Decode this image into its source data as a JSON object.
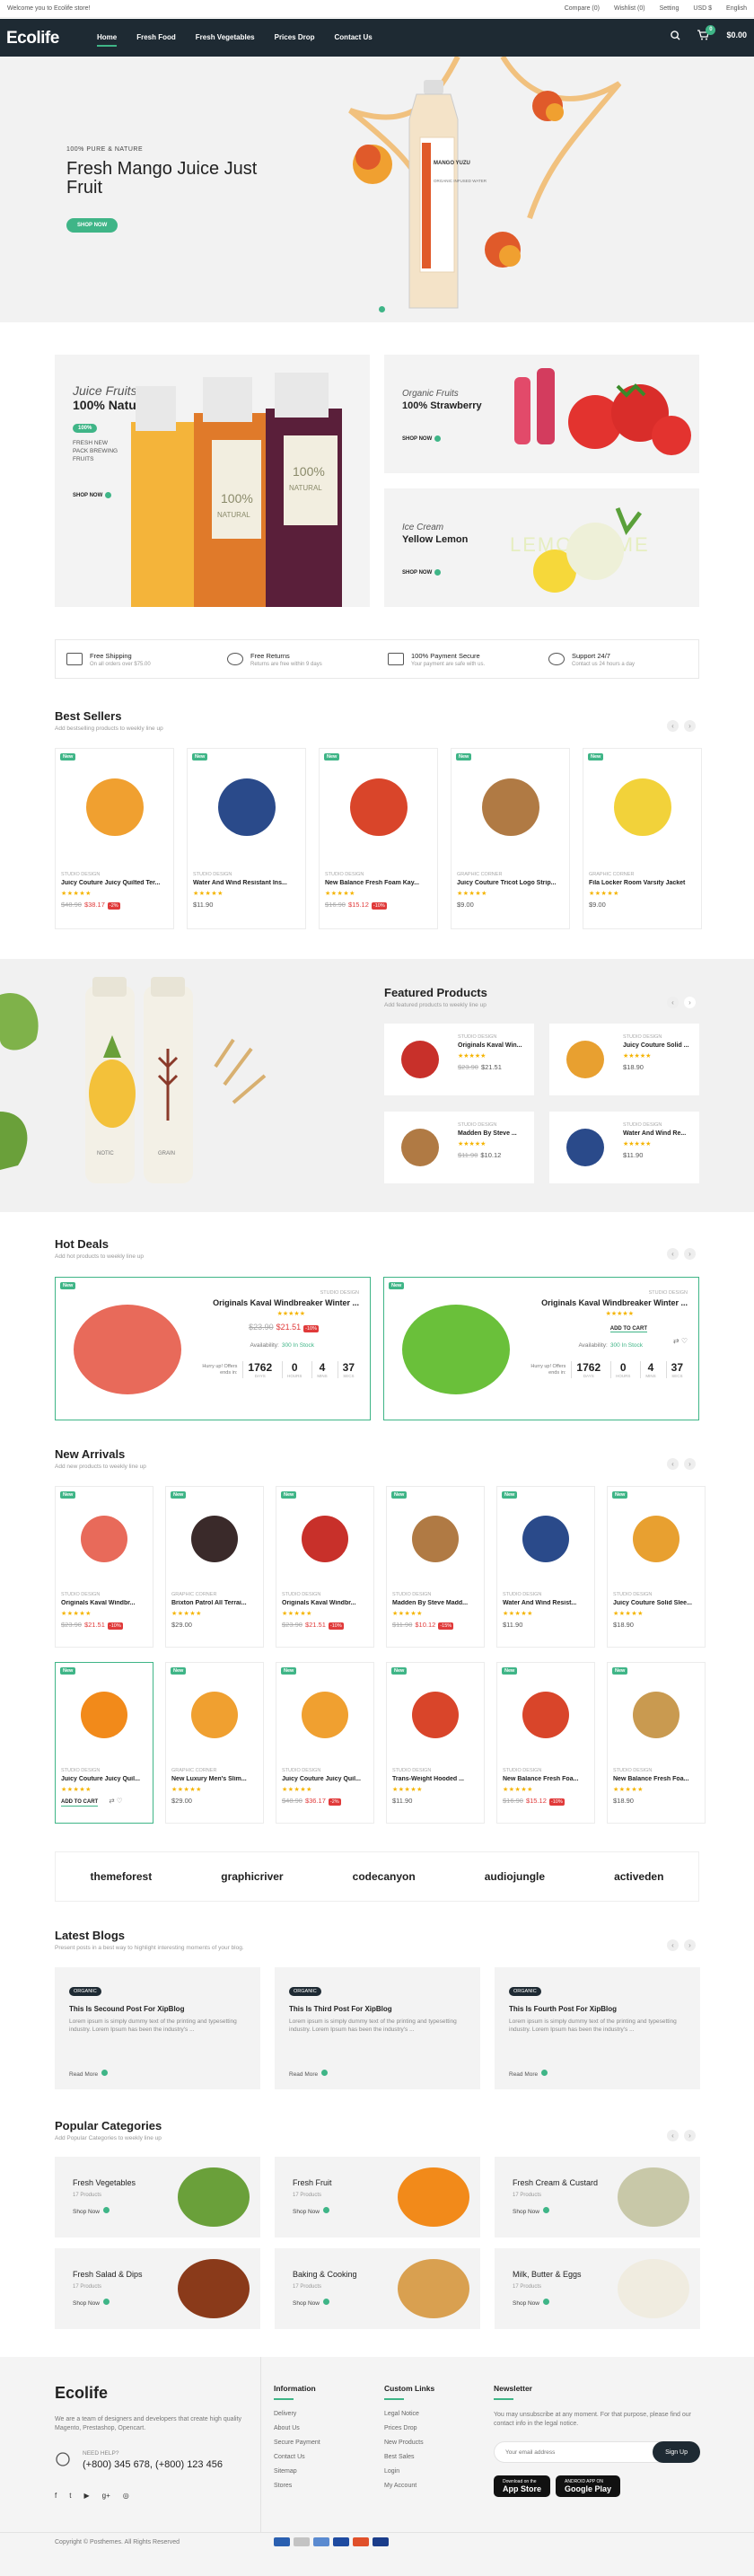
{
  "topbar": {
    "welcome": "Welcome you to Ecolife store!",
    "links": [
      "Compare (0)",
      "Wishlist (0)",
      "Setting",
      "USD $",
      "English"
    ]
  },
  "nav": {
    "logo": "Ecolife",
    "menu": [
      "Home",
      "Fresh Food",
      "Fresh Vegetables",
      "Prices Drop",
      "Contact Us"
    ],
    "cart_count": "0",
    "cart_total": "$0.00"
  },
  "hero": {
    "subtitle": "100% PURE & NATURE",
    "title": "Fresh Mango Juice Just Fruit",
    "button": "SHOP NOW",
    "bottle_label": "MANGO YUZU",
    "bottle_sub": "ORGANIC INFUSED WATER"
  },
  "banners": {
    "b1": {
      "t1": "Juice Fruits",
      "t2": "100% Natural",
      "tag": "100%",
      "desc": "FRESH NEW PACK BREWING FRUITS",
      "link": "SHOP NOW",
      "label": "NATURAL",
      "label2": "100%"
    },
    "b2": {
      "t1": "Organic Fruits",
      "t2": "100% Strawberry",
      "link": "SHOP NOW"
    },
    "b3": {
      "t1": "Ice Cream",
      "t2": "Yellow Lemon",
      "link": "SHOP NOW",
      "bg": "LEMON LIME"
    }
  },
  "features": [
    {
      "title": "Free Shipping",
      "desc": "On all orders over $75.00"
    },
    {
      "title": "Free Returns",
      "desc": "Returns are free within 9 days"
    },
    {
      "title": "100% Payment Secure",
      "desc": "Your payment are safe with us."
    },
    {
      "title": "Support 24/7",
      "desc": "Contact us 24 hours a day"
    }
  ],
  "best_sellers": {
    "title": "Best Sellers",
    "subtitle": "Add bestselling products to weekly line up",
    "items": [
      {
        "brand": "STUDIO DESIGN",
        "name": "Juicy Couture Juicy Quilted Ter...",
        "old": "$48.90",
        "price": "$38.17",
        "off": "-2%"
      },
      {
        "brand": "STUDIO DESIGN",
        "name": "Water And Wind Resistant Ins...",
        "price": "$11.90"
      },
      {
        "brand": "STUDIO DESIGN",
        "name": "New Balance Fresh Foam Kay...",
        "old": "$16.90",
        "price": "$15.12",
        "off": "-10%"
      },
      {
        "brand": "GRAPHIC CORNER",
        "name": "Juicy Couture Tricot Logo Strip...",
        "price": "$9.00"
      },
      {
        "brand": "GRAPHIC CORNER",
        "name": "Fila Locker Room Varsity Jacket",
        "price": "$9.00"
      }
    ]
  },
  "featured": {
    "title": "Featured Products",
    "subtitle": "Add featured products to weekly line up",
    "items": [
      {
        "brand": "STUDIO DESIGN",
        "name": "Originals Kaval Win...",
        "old": "$23.90",
        "price": "$21.51"
      },
      {
        "brand": "STUDIO DESIGN",
        "name": "Juicy Couture Solid ...",
        "price": "$18.90"
      },
      {
        "brand": "STUDIO DESIGN",
        "name": "Madden By Steve ...",
        "old": "$11.90",
        "price": "$10.12"
      },
      {
        "brand": "STUDIO DESIGN",
        "name": "Water And Wind Re...",
        "price": "$11.90"
      }
    ],
    "bottle1": "NOTIC",
    "bottle2": "GRAIN"
  },
  "hot_deals": {
    "title": "Hot Deals",
    "subtitle": "Add hot products to weekly line up",
    "items": [
      {
        "brand": "STUDIO DESIGN",
        "name": "Originals Kaval Windbreaker Winter ...",
        "old": "$23.90",
        "price": "$21.51",
        "off": "-10%",
        "availability": "Availability:",
        "stock": "300 In Stock",
        "hurry": "Hurry up! Offers ends in:",
        "d": "1762",
        "h": "0",
        "m": "4",
        "s": "37"
      },
      {
        "brand": "STUDIO DESIGN",
        "name": "Originals Kaval Windbreaker Winter ...",
        "cart": "ADD TO CART",
        "availability": "Availability:",
        "stock": "300 In Stock",
        "hurry": "Hurry up! Offers ends in:",
        "d": "1762",
        "h": "0",
        "m": "4",
        "s": "37"
      }
    ],
    "labels": {
      "d": "DAYS",
      "h": "HOURS",
      "m": "MINS",
      "s": "SECS"
    }
  },
  "new_arrivals": {
    "title": "New Arrivals",
    "subtitle": "Add new products to weekly line up",
    "row1": [
      {
        "brand": "STUDIO DESIGN",
        "name": "Originals Kaval Windbr...",
        "old": "$23.90",
        "price": "$21.51",
        "off": "-10%"
      },
      {
        "brand": "GRAPHIC CORNER",
        "name": "Brixton Patrol All Terrai...",
        "price": "$29.00"
      },
      {
        "brand": "STUDIO DESIGN",
        "name": "Originals Kaval Windbr...",
        "old": "$23.90",
        "price": "$21.51",
        "off": "-10%"
      },
      {
        "brand": "STUDIO DESIGN",
        "name": "Madden By Steve Madd...",
        "old": "$11.90",
        "price": "$10.12",
        "off": "-15%"
      },
      {
        "brand": "STUDIO DESIGN",
        "name": "Water And Wind Resist...",
        "price": "$11.90"
      },
      {
        "brand": "STUDIO DESIGN",
        "name": "Juicy Couture Solid Slee...",
        "price": "$18.90"
      }
    ],
    "row2": [
      {
        "brand": "STUDIO DESIGN",
        "name": "Juicy Couture Juicy Quil...",
        "cart": "ADD TO CART"
      },
      {
        "brand": "GRAPHIC CORNER",
        "name": "New Luxury Men's Slim...",
        "price": "$29.00"
      },
      {
        "brand": "STUDIO DESIGN",
        "name": "Juicy Couture Juicy Quil...",
        "old": "$48.90",
        "price": "$36.17",
        "off": "-2%"
      },
      {
        "brand": "STUDIO DESIGN",
        "name": "Trans-Weight Hooded ...",
        "price": "$11.90"
      },
      {
        "brand": "STUDIO DESIGN",
        "name": "New Balance Fresh Foa...",
        "old": "$16.90",
        "price": "$15.12",
        "off": "-10%"
      },
      {
        "brand": "STUDIO DESIGN",
        "name": "New Balance Fresh Foa...",
        "price": "$18.90"
      }
    ]
  },
  "brands": [
    "themeforest",
    "graphicriver",
    "codecanyon",
    "audiojungle",
    "activeden"
  ],
  "blogs": {
    "title": "Latest Blogs",
    "subtitle": "Present posts in a best way to highlight interesting moments of your blog.",
    "items": [
      {
        "tag": "ORGANIC",
        "title": "This Is Secound Post For XipBlog",
        "body": "Lorem ipsum is simply dummy text of the printing and typesetting industry. Lorem Ipsum has been the industry's ...",
        "more": "Read More"
      },
      {
        "tag": "ORGANIC",
        "title": "This Is Third Post For XipBlog",
        "body": "Lorem ipsum is simply dummy text of the printing and typesetting industry. Lorem Ipsum has been the industry's ...",
        "more": "Read More"
      },
      {
        "tag": "ORGANIC",
        "title": "This Is Fourth Post For XipBlog",
        "body": "Lorem ipsum is simply dummy text of the printing and typesetting industry. Lorem Ipsum has been the industry's ...",
        "more": "Read More"
      }
    ]
  },
  "categories": {
    "title": "Popular Categories",
    "subtitle": "Add Popular Categories to weekly line up",
    "items": [
      {
        "name": "Fresh Vegetables",
        "count": "17 Products",
        "link": "Shop Now"
      },
      {
        "name": "Fresh Fruit",
        "count": "17 Products",
        "link": "Shop Now"
      },
      {
        "name": "Fresh Cream & Custard",
        "count": "17 Products",
        "link": "Shop Now"
      },
      {
        "name": "Fresh Salad & Dips",
        "count": "17 Products",
        "link": "Shop Now"
      },
      {
        "name": "Baking & Cooking",
        "count": "17 Products",
        "link": "Shop Now"
      },
      {
        "name": "Milk, Butter & Eggs",
        "count": "17 Products",
        "link": "Shop Now"
      }
    ]
  },
  "footer": {
    "logo": "Ecolife",
    "about": "We are a team of designers and developers that create high quality Magento, Prestashop, Opencart.",
    "help_label": "NEED HELP?",
    "phone": "(+800) 345 678, (+800) 123 456",
    "info_title": "Information",
    "info": [
      "Delivery",
      "About Us",
      "Secure Payment",
      "Contact Us",
      "Sitemap",
      "Stores"
    ],
    "custom_title": "Custom Links",
    "custom": [
      "Legal Notice",
      "Prices Drop",
      "New Products",
      "Best Sales",
      "Login",
      "My Account"
    ],
    "news_title": "Newsletter",
    "news_text": "You may unsubscribe at any moment. For that purpose, please find our contact info in the legal notice.",
    "email_placeholder": "Your email address",
    "signup": "Sign Up",
    "appstore_small": "Download on the",
    "appstore": "App Store",
    "gplay_small": "ANDROID APP ON",
    "gplay": "Google Play",
    "copyright": "Copyright © Posthemes. All Rights Reserved"
  },
  "colors": {
    "accent": "#3fb587",
    "dark": "#1e2a33",
    "sale": "#e03a3a",
    "star": "#f5b400"
  }
}
